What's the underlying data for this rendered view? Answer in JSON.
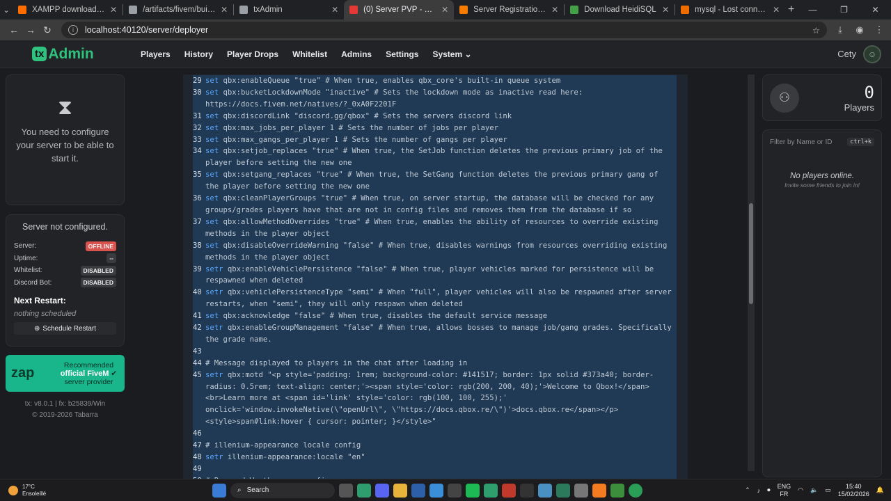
{
  "browser": {
    "tabs": [
      {
        "title": "XAMPP download | SourceForge",
        "color": "#ff6d00",
        "active": false
      },
      {
        "title": "/artifacts/fivem/build_server_w",
        "color": "#9aa0a6",
        "active": false
      },
      {
        "title": "txAdmin",
        "color": "#9aa0a6",
        "active": false
      },
      {
        "title": "(0) Server PVP - Server Deployer",
        "color": "#e53935",
        "active": true
      },
      {
        "title": "Server Registration Keys - Cfx.re",
        "color": "#f57c00",
        "active": false
      },
      {
        "title": "Download HeidiSQL",
        "color": "#43a047",
        "active": false
      },
      {
        "title": "mysql - Lost connection to server",
        "color": "#ef6c00",
        "active": false
      }
    ],
    "url": "localhost:40120/server/deployer"
  },
  "nav": {
    "logo_tx": "tx",
    "logo_admin": "Admin",
    "items": [
      "Players",
      "History",
      "Player Drops",
      "Whitelist",
      "Admins",
      "Settings",
      "System ⌄"
    ],
    "user": "Cety"
  },
  "left": {
    "configure_msg": "You need to configure your server to be able to start it.",
    "status_title": "Server not configured.",
    "rows": [
      {
        "label": "Server:",
        "value": "OFFLINE",
        "style": "red"
      },
      {
        "label": "Uptime:",
        "value": "--",
        "style": "plain"
      },
      {
        "label": "Whitelist:",
        "value": "DISABLED",
        "style": "plain"
      },
      {
        "label": "Discord Bot:",
        "value": "DISABLED",
        "style": "plain"
      }
    ],
    "next_restart": "Next Restart:",
    "nothing": "nothing scheduled",
    "schedule": "Schedule Restart",
    "zap_logo": "zap",
    "zap_line1": "Recommended",
    "zap_line2": "official FiveM",
    "zap_line3": "server provider",
    "version": "tx: v8.0.1 | fx: b25839/Win",
    "copyright": "© 2019-2026 Tabarra"
  },
  "code_lines": [
    {
      "n": "29",
      "kw": "set",
      "rest": " qbx:enableQueue \"true\" # When true, enables qbx_core's built-in queue system"
    },
    {
      "n": "30",
      "kw": "set",
      "rest": " qbx:bucketLockdownMode \"inactive\" # Sets the lockdown mode as inactive read here: https://docs.fivem.net/natives/?_0xA0F2201F"
    },
    {
      "n": "31",
      "kw": "set",
      "rest": " qbx:discordLink \"discord.gg/qbox\" # Sets the servers discord link"
    },
    {
      "n": "32",
      "kw": "set",
      "rest": " qbx:max_jobs_per_player 1 # Sets the number of jobs per player"
    },
    {
      "n": "33",
      "kw": "set",
      "rest": " qbx:max_gangs_per_player 1 # Sets the number of gangs per player"
    },
    {
      "n": "34",
      "kw": "set",
      "rest": " qbx:setjob_replaces \"true\" # When true, the SetJob function deletes the previous primary job of the player before setting the new one"
    },
    {
      "n": "35",
      "kw": "set",
      "rest": " qbx:setgang_replaces \"true\" # When true, the SetGang function deletes the previous primary gang of the player before setting the new one"
    },
    {
      "n": "36",
      "kw": "set",
      "rest": " qbx:cleanPlayerGroups \"true\" # When true, on server startup, the database will be checked for any groups/grades players have that are not in config files and removes them from the database if so"
    },
    {
      "n": "37",
      "kw": "set",
      "rest": " qbx:allowMethodOverrides \"true\" # When true, enables the ability of resources to override existing methods in the player object"
    },
    {
      "n": "38",
      "kw": "set",
      "rest": " qbx:disableOverrideWarning \"false\" # When true, disables warnings from resources overriding existing methods in the player object"
    },
    {
      "n": "39",
      "kw": "setr",
      "rest": " qbx:enableVehiclePersistence \"false\" # When true, player vehicles marked for persistence will be respawned when deleted"
    },
    {
      "n": "40",
      "kw": "setr",
      "rest": " qbx:vehiclePersistenceType \"semi\" # When \"full\", player vehicles will also be respawned after server restarts, when \"semi\", they will only respawn when deleted"
    },
    {
      "n": "41",
      "kw": "set",
      "rest": " qbx:acknowledge \"false\" # When true, disables the default service message"
    },
    {
      "n": "42",
      "kw": "setr",
      "rest": " qbx:enableGroupManagement \"false\" # When true, allows bosses to manage job/gang grades. Specifically the grade name."
    },
    {
      "n": "43",
      "kw": "",
      "rest": ""
    },
    {
      "n": "44",
      "kw": "",
      "rest": "# Message displayed to players in the chat after loading in"
    },
    {
      "n": "45",
      "kw": "setr",
      "rest": " qbx:motd \"<p style='padding: 1rem; background-color: #141517; border: 1px solid #373a40; border-radius: 0.5rem; text-align: center;'><span style='color: rgb(200, 200, 40);'>Welcome to Qbox!</span><br>Learn more at <span id='link' style='color: rgb(100, 100, 255);' onclick='window.invokeNative(\\\"openUrl\\\", \\\"https://docs.qbox.re/\\\")'>docs.qbox.re</span></p><style>span#link:hover { cursor: pointer; }</style>\""
    },
    {
      "n": "46",
      "kw": "",
      "rest": ""
    },
    {
      "n": "47",
      "kw": "",
      "rest": "# illenium-appearance locale config"
    },
    {
      "n": "48",
      "kw": "setr",
      "rest": " illenium-appearance:locale \"en\""
    },
    {
      "n": "49",
      "kw": "",
      "rest": ""
    },
    {
      "n": "50",
      "kw": "",
      "rest": "# Renewed-Weathersync config"
    }
  ],
  "right": {
    "player_count": "0",
    "players_label": "Players",
    "filter_placeholder": "Filter by Name or ID",
    "shortcut": "ctrl+k",
    "no_players": "No players online.",
    "invite": "Invite some friends to join in!"
  },
  "taskbar": {
    "temp": "17°C",
    "weather": "Ensoleillé",
    "search": "Search",
    "lang1": "ENG",
    "lang2": "FR",
    "time": "15:40",
    "date": "15/02/2026"
  }
}
